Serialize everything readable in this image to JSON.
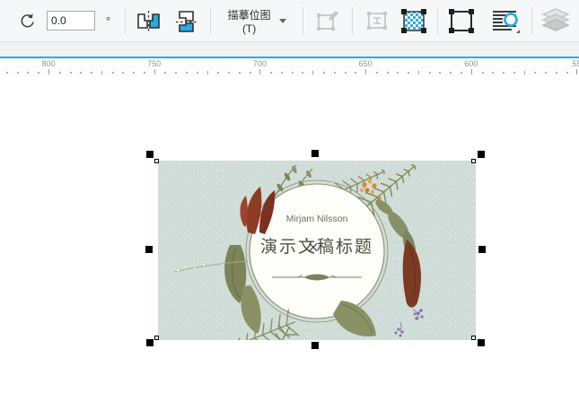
{
  "toolbar": {
    "rotation": {
      "value": "0.0",
      "degree_symbol": "°"
    },
    "trace_button": {
      "label": "描摹位图(T)"
    },
    "icon_names": [
      "rotate-ccw-icon",
      "mirror-horizontal-icon",
      "mirror-vertical-icon",
      "edit-bitmap-icon",
      "resample-bitmap-icon",
      "bitmap-boundary-icon",
      "crop-frame-icon",
      "wrap-text-icon",
      "layers-icon"
    ],
    "accent_color": "#29abe3"
  },
  "ruler": {
    "labels": [
      "800",
      "750",
      "700",
      "650",
      "600",
      "55"
    ]
  },
  "canvas": {
    "artwork": {
      "author": "Mirjam Nilsson",
      "title": "演示文稿标题",
      "colors": {
        "background": "#cfdcd7",
        "circle_fill": "#fdfdfa",
        "ring": "#8a8f6a",
        "author_text": "#6b705c",
        "title_text": "#4c5340",
        "olive": "#7d8458",
        "dark_red": "#8e3c24",
        "orange": "#d98a2e",
        "purple": "#8a6db8"
      }
    }
  }
}
